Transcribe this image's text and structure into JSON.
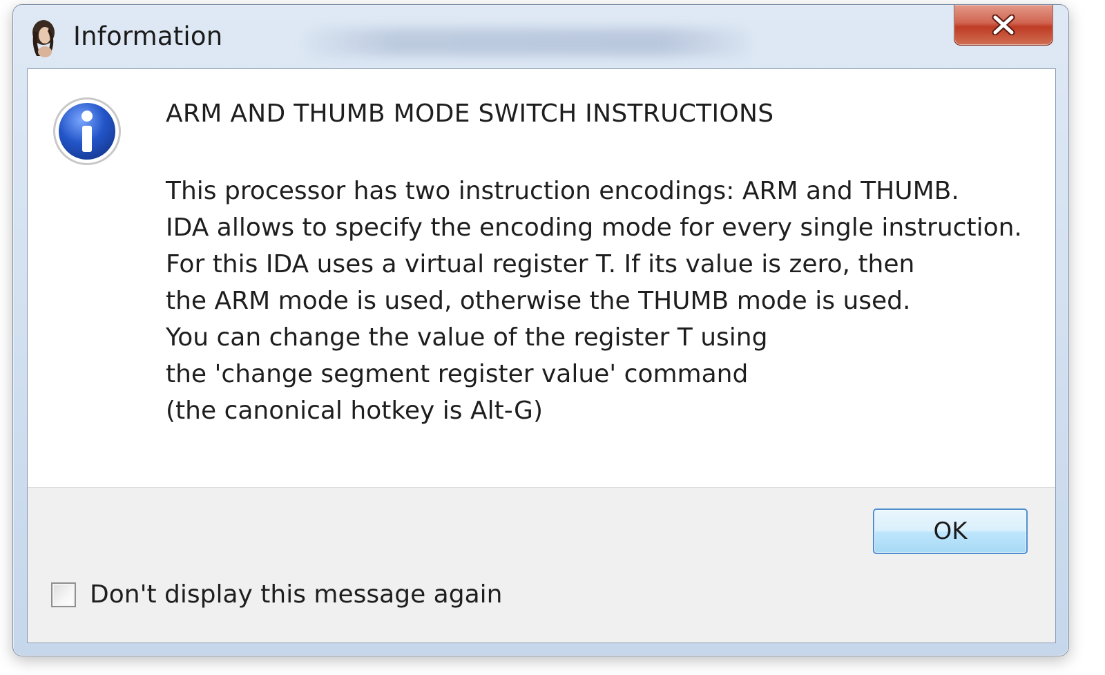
{
  "window": {
    "title": "Information",
    "close_icon": "close-x-icon",
    "app_icon": "ida-portrait-icon"
  },
  "message": {
    "icon": "information-icon",
    "heading": "ARM AND THUMB MODE SWITCH INSTRUCTIONS",
    "lines": [
      "This processor has two instruction encodings: ARM and THUMB.",
      "IDA allows to specify the encoding mode for every single instruction.",
      "For this IDA uses a virtual register T. If its value is zero, then",
      "the ARM mode is used, otherwise the THUMB mode is used.",
      "You can change the value of the register T using",
      "the 'change segment register value' command",
      "(the canonical hotkey is Alt-G)"
    ]
  },
  "footer": {
    "ok_label": "OK",
    "dont_show_label": "Don't display this message again",
    "dont_show_checked": false
  },
  "colors": {
    "close_button": "#c9452d",
    "info_icon_blue": "#1f4fb8",
    "ok_border": "#4e8fcf"
  }
}
